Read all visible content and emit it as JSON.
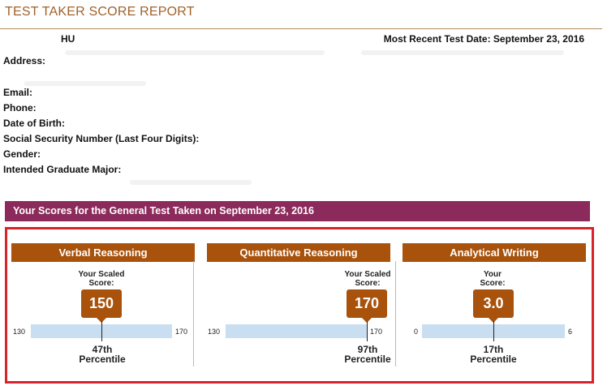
{
  "header": {
    "report_title": "TEST TAKER SCORE REPORT",
    "name": "HU",
    "test_date": "Most Recent Test Date: September 23, 2016"
  },
  "fields": [
    {
      "label": "Address:"
    },
    {
      "label": "Email:"
    },
    {
      "label": "Phone:"
    },
    {
      "label": "Date of Birth:"
    },
    {
      "label": "Social Security Number (Last Four Digits):"
    },
    {
      "label": "Gender:"
    },
    {
      "label": "Intended Graduate Major:"
    }
  ],
  "scores_banner": "Your Scores for the General Test Taken on September 23, 2016",
  "sections": [
    {
      "title": "Verbal Reasoning",
      "scaled_label_1": "Your Scaled",
      "scaled_label_2": "Score:",
      "score": "150",
      "score_value": 150,
      "min": "130",
      "max": "170",
      "min_value": 130,
      "max_value": 170,
      "percentile_1": "47th",
      "percentile_2": "Percentile"
    },
    {
      "title": "Quantitative Reasoning",
      "scaled_label_1": "Your Scaled",
      "scaled_label_2": "Score:",
      "score": "170",
      "score_value": 170,
      "min": "130",
      "max": "170",
      "min_value": 130,
      "max_value": 170,
      "percentile_1": "97th",
      "percentile_2": "Percentile"
    },
    {
      "title": "Analytical Writing",
      "scaled_label_1": "Your",
      "scaled_label_2": "Score:",
      "score": "3.0",
      "score_value": 3.0,
      "min": "0",
      "max": "6",
      "min_value": 0,
      "max_value": 6,
      "percentile_1": "17th",
      "percentile_2": "Percentile"
    }
  ],
  "colors": {
    "title": "#a0622a",
    "banner": "#8b2a5b",
    "section_header": "#a8520c",
    "score_box": "#a8520c",
    "bar": "#c9def0",
    "frame": "#d8232a"
  }
}
